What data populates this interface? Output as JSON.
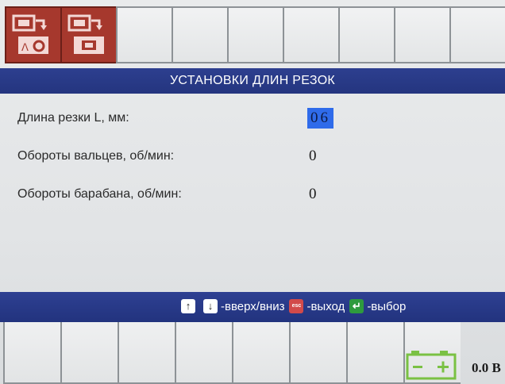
{
  "title": "УСТАНОВКИ ДЛИН РЕЗОК",
  "settings": [
    {
      "label": "Длина резки L, мм:",
      "value": "06"
    },
    {
      "label": "Обороты вальцев, об/мин:",
      "value": "0"
    },
    {
      "label": "Обороты барабана, об/мин:",
      "value": "0"
    }
  ],
  "help": {
    "up_icon": "arrow-up-icon",
    "down_icon": "arrow-down-icon",
    "updown_text": "-вверх/вниз",
    "esc_label": "esc",
    "exit_text": "-выход",
    "select_text": "-выбор"
  },
  "battery": {
    "icon": "battery-icon",
    "value": "0.0 В"
  },
  "colors": {
    "title_bar": "#24357f",
    "active_softkey": "#a6382d",
    "selected_value": "#2f6bea",
    "battery_icon": "#7ac143"
  }
}
